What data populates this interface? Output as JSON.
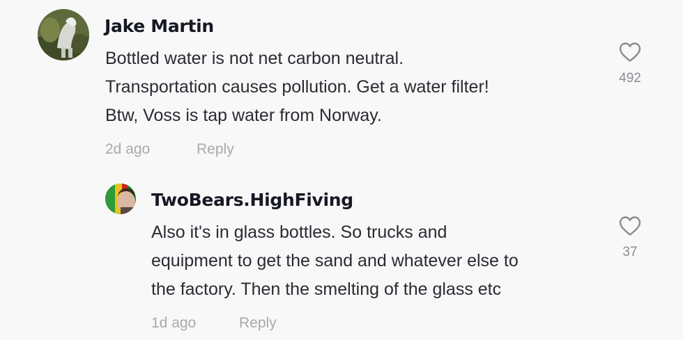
{
  "comments": [
    {
      "username": "Jake Martin",
      "lines": [
        "Bottled water is not net carbon neutral.",
        "Transportation causes pollution. Get a water filter!",
        "Btw, Voss is tap water from Norway."
      ],
      "time": "2d ago",
      "reply_label": "Reply",
      "likes": "492"
    },
    {
      "username": "TwoBears.HighFiving",
      "lines": [
        "Also it's in glass bottles. So trucks and",
        "equipment to get the sand and whatever else to",
        "the factory. Then the smelting of the glass etc"
      ],
      "time": "1d ago",
      "reply_label": "Reply",
      "likes": "37"
    }
  ],
  "icons": {
    "like": "heart-outline-icon"
  },
  "colors": {
    "background": "#f8f8f8",
    "username": "#161823",
    "text": "#2a2b33",
    "meta": "#a8a9ad"
  }
}
